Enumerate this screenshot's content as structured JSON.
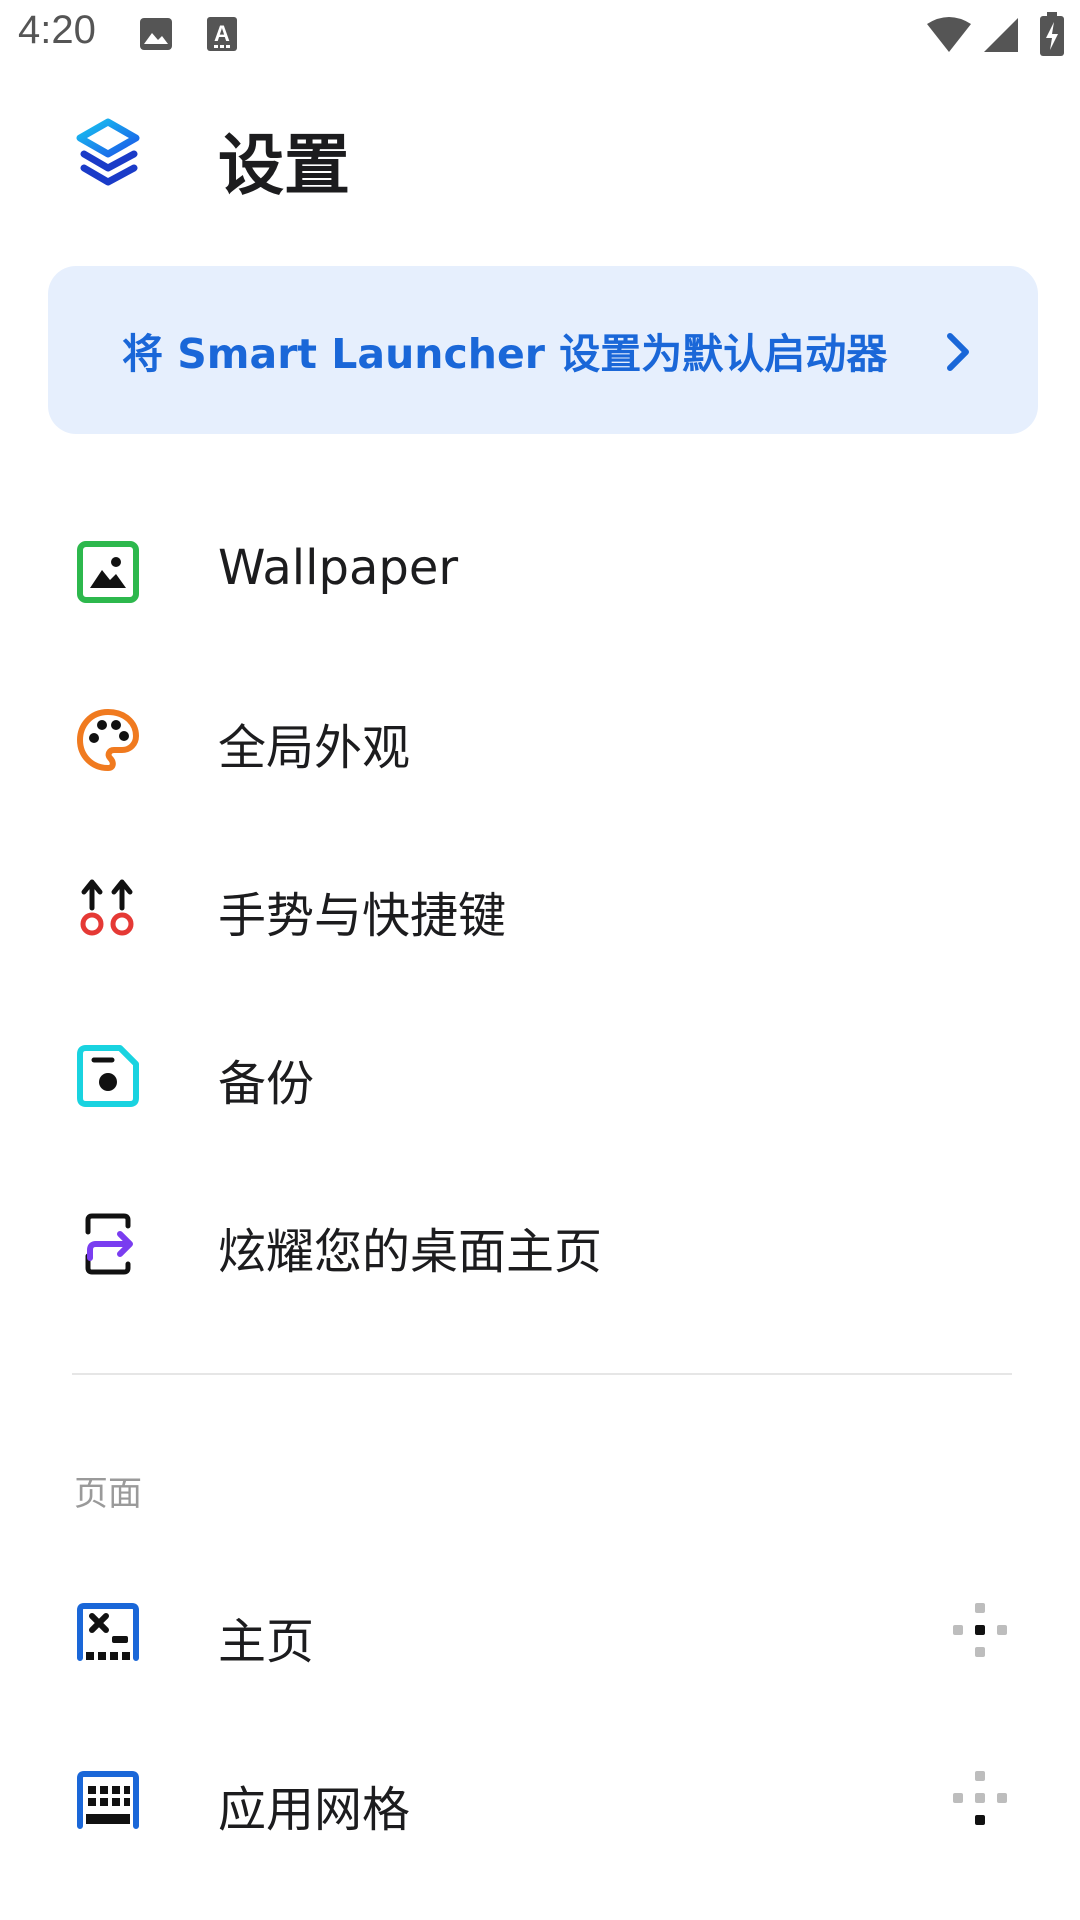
{
  "status_bar": {
    "time": "4:20",
    "icons": [
      "image-icon",
      "keyboard-a-icon",
      "wifi-icon",
      "signal-icon",
      "battery-charging-icon"
    ]
  },
  "header": {
    "title": "设置",
    "logo_icon": "smart-launcher-logo"
  },
  "banner": {
    "text": "将 Smart Launcher 设置为默认启动器",
    "icon": "chevron-right-icon",
    "color": "#1a67d8",
    "background": "#e6effd"
  },
  "menu": {
    "items": [
      {
        "label": "Wallpaper",
        "icon": "wallpaper-icon",
        "color": "#2db84d"
      },
      {
        "label": "全局外观",
        "icon": "palette-icon",
        "color": "#f07a1f"
      },
      {
        "label": "手势与快捷键",
        "icon": "gestures-icon",
        "color": "#e53935"
      },
      {
        "label": "备份",
        "icon": "backup-icon",
        "color": "#19d3e0"
      },
      {
        "label": "炫耀您的桌面主页",
        "icon": "share-icon",
        "color": "#7a3df0"
      }
    ]
  },
  "pages_section": {
    "header": "页面",
    "items": [
      {
        "label": "主页",
        "icon": "homepage-icon",
        "trailing_icon": "dpad-center-icon",
        "color": "#1a67d8"
      },
      {
        "label": "应用网格",
        "icon": "app-grid-icon",
        "trailing_icon": "dpad-down-icon",
        "color": "#1a67d8"
      }
    ]
  }
}
